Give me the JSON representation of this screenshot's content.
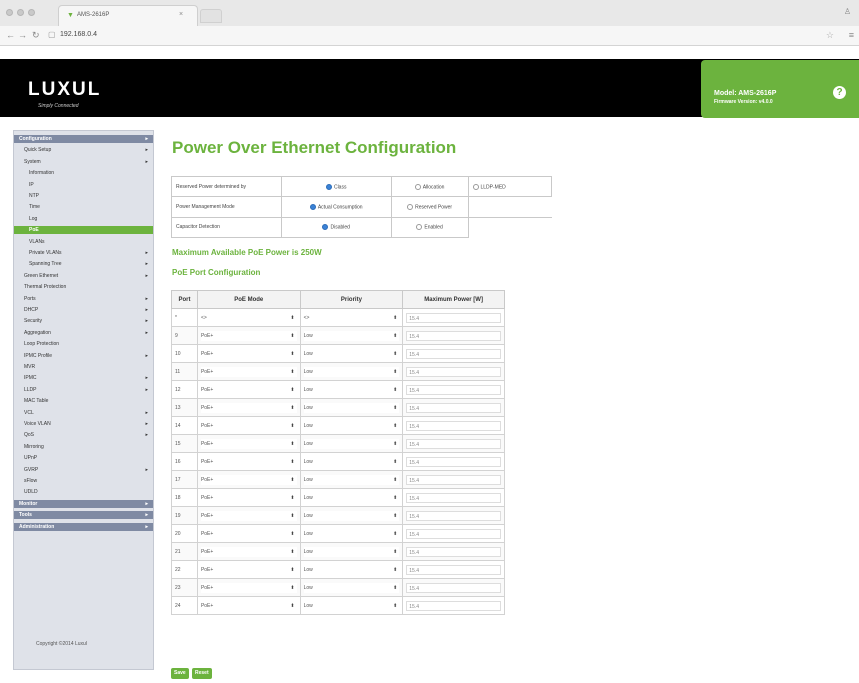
{
  "browser": {
    "tab_title": "AMS-2616P",
    "tab_close": "×",
    "url": "192.168.0.4",
    "menu_glyph": "≡"
  },
  "header": {
    "logo": "LUXUL",
    "tagline": "Simply Connected",
    "model": "Model: AMS-2616P",
    "firmware": "Firmware Version: v4.0.0",
    "help": "?"
  },
  "sidebar": {
    "items": [
      {
        "label": "Configuration",
        "level": 0,
        "arrow": true
      },
      {
        "label": "Quick Setup",
        "level": 1,
        "arrow": true
      },
      {
        "label": "System",
        "level": 1,
        "arrow": true
      },
      {
        "label": "Information",
        "level": 2,
        "arrow": false
      },
      {
        "label": "IP",
        "level": 2,
        "arrow": false
      },
      {
        "label": "NTP",
        "level": 2,
        "arrow": false
      },
      {
        "label": "Time",
        "level": 2,
        "arrow": false
      },
      {
        "label": "Log",
        "level": 2,
        "arrow": false
      },
      {
        "label": "PoE",
        "level": 2,
        "arrow": false,
        "active": true
      },
      {
        "label": "VLANs",
        "level": 2,
        "arrow": false
      },
      {
        "label": "Private VLANs",
        "level": 2,
        "arrow": true
      },
      {
        "label": "Spanning Tree",
        "level": 2,
        "arrow": true
      },
      {
        "label": "Green Ethernet",
        "level": 1,
        "arrow": true
      },
      {
        "label": "Thermal Protection",
        "level": 1,
        "arrow": false
      },
      {
        "label": "Ports",
        "level": 1,
        "arrow": true
      },
      {
        "label": "DHCP",
        "level": 1,
        "arrow": true
      },
      {
        "label": "Security",
        "level": 1,
        "arrow": true
      },
      {
        "label": "Aggregation",
        "level": 1,
        "arrow": true
      },
      {
        "label": "Loop Protection",
        "level": 1,
        "arrow": false
      },
      {
        "label": "IPMC Profile",
        "level": 1,
        "arrow": true
      },
      {
        "label": "MVR",
        "level": 1,
        "arrow": false
      },
      {
        "label": "IPMC",
        "level": 1,
        "arrow": true
      },
      {
        "label": "LLDP",
        "level": 1,
        "arrow": true
      },
      {
        "label": "MAC Table",
        "level": 1,
        "arrow": false
      },
      {
        "label": "VCL",
        "level": 1,
        "arrow": true
      },
      {
        "label": "Voice VLAN",
        "level": 1,
        "arrow": true
      },
      {
        "label": "QoS",
        "level": 1,
        "arrow": true
      },
      {
        "label": "Mirroring",
        "level": 1,
        "arrow": false
      },
      {
        "label": "UPnP",
        "level": 1,
        "arrow": false
      },
      {
        "label": "GVRP",
        "level": 1,
        "arrow": true
      },
      {
        "label": "sFlow",
        "level": 1,
        "arrow": false
      },
      {
        "label": "UDLD",
        "level": 1,
        "arrow": false
      },
      {
        "label": "Monitor",
        "level": 0,
        "arrow": true
      },
      {
        "label": "Tools",
        "level": 0,
        "arrow": true
      },
      {
        "label": "Administration",
        "level": 0,
        "arrow": true
      }
    ],
    "arrow_glyph": "▸",
    "copyright": "Copyright ©2014 Luxul"
  },
  "main": {
    "title": "Power Over Ethernet Configuration",
    "config": {
      "row1_label": "Reserved Power determined by",
      "row1_opt1": "Class",
      "row1_opt2": "Allocation",
      "row1_opt3": "LLDP-MED",
      "row2_label": "Power Management Mode",
      "row2_opt1": "Actual Consumption",
      "row2_opt2": "Reserved Power",
      "row3_label": "Capacitor Detection",
      "row3_opt1": "Disabled",
      "row3_opt2": "Enabled"
    },
    "max_power_text": "Maximum Available PoE Power is 250W",
    "port_config_title": "PoE Port Configuration",
    "table_headers": [
      "Port",
      "PoE Mode",
      "Priority",
      "Maximum Power [W]"
    ],
    "rows": [
      {
        "port": "*",
        "mode": "<>",
        "priority": "<>",
        "power": "15.4"
      },
      {
        "port": "9",
        "mode": "PoE+",
        "priority": "Low",
        "power": "15.4"
      },
      {
        "port": "10",
        "mode": "PoE+",
        "priority": "Low",
        "power": "15.4"
      },
      {
        "port": "11",
        "mode": "PoE+",
        "priority": "Low",
        "power": "15.4"
      },
      {
        "port": "12",
        "mode": "PoE+",
        "priority": "Low",
        "power": "15.4"
      },
      {
        "port": "13",
        "mode": "PoE+",
        "priority": "Low",
        "power": "15.4"
      },
      {
        "port": "14",
        "mode": "PoE+",
        "priority": "Low",
        "power": "15.4"
      },
      {
        "port": "15",
        "mode": "PoE+",
        "priority": "Low",
        "power": "15.4"
      },
      {
        "port": "16",
        "mode": "PoE+",
        "priority": "Low",
        "power": "15.4"
      },
      {
        "port": "17",
        "mode": "PoE+",
        "priority": "Low",
        "power": "15.4"
      },
      {
        "port": "18",
        "mode": "PoE+",
        "priority": "Low",
        "power": "15.4"
      },
      {
        "port": "19",
        "mode": "PoE+",
        "priority": "Low",
        "power": "15.4"
      },
      {
        "port": "20",
        "mode": "PoE+",
        "priority": "Low",
        "power": "15.4"
      },
      {
        "port": "21",
        "mode": "PoE+",
        "priority": "Low",
        "power": "15.4"
      },
      {
        "port": "22",
        "mode": "PoE+",
        "priority": "Low",
        "power": "15.4"
      },
      {
        "port": "23",
        "mode": "PoE+",
        "priority": "Low",
        "power": "15.4"
      },
      {
        "port": "24",
        "mode": "PoE+",
        "priority": "Low",
        "power": "15.4"
      }
    ],
    "save_label": "Save",
    "reset_label": "Reset"
  }
}
